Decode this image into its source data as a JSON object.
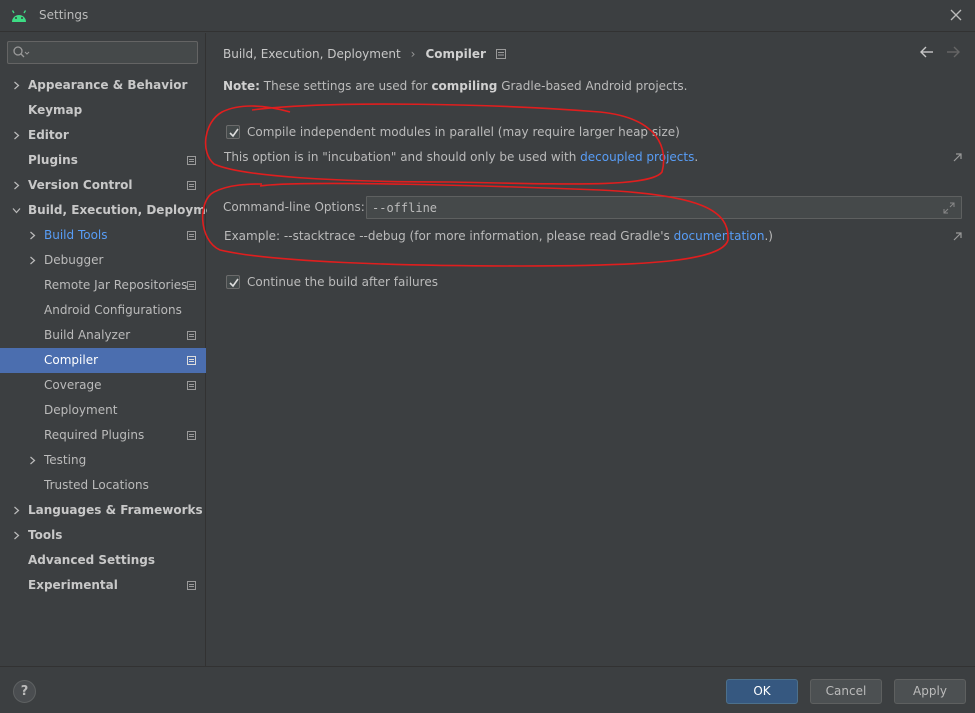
{
  "window": {
    "title": "Settings"
  },
  "sidebar": {
    "search_placeholder": "",
    "items": [
      {
        "label": "Appearance & Behavior",
        "bold": true,
        "chevron": "right",
        "level": 0
      },
      {
        "label": "Keymap",
        "bold": true,
        "chevron": "none",
        "level": 0
      },
      {
        "label": "Editor",
        "bold": true,
        "chevron": "right",
        "level": 0
      },
      {
        "label": "Plugins",
        "bold": true,
        "chevron": "none",
        "level": 0,
        "project": true
      },
      {
        "label": "Version Control",
        "bold": true,
        "chevron": "right",
        "level": 0,
        "project": true
      },
      {
        "label": "Build, Execution, Deployment",
        "bold": true,
        "chevron": "down",
        "level": 0
      },
      {
        "label": "Build Tools",
        "chevron": "right",
        "level": 1,
        "project": true,
        "link": true
      },
      {
        "label": "Debugger",
        "chevron": "right",
        "level": 1
      },
      {
        "label": "Remote Jar Repositories",
        "chevron": "none",
        "level": 1,
        "project": true
      },
      {
        "label": "Android Configurations",
        "chevron": "none",
        "level": 1
      },
      {
        "label": "Build Analyzer",
        "chevron": "none",
        "level": 1,
        "project": true
      },
      {
        "label": "Compiler",
        "chevron": "none",
        "level": 1,
        "project": true,
        "selected": true
      },
      {
        "label": "Coverage",
        "chevron": "none",
        "level": 1,
        "project": true
      },
      {
        "label": "Deployment",
        "chevron": "none",
        "level": 1
      },
      {
        "label": "Required Plugins",
        "chevron": "none",
        "level": 1,
        "project": true
      },
      {
        "label": "Testing",
        "chevron": "right",
        "level": 1
      },
      {
        "label": "Trusted Locations",
        "chevron": "none",
        "level": 1
      },
      {
        "label": "Languages & Frameworks",
        "bold": true,
        "chevron": "right",
        "level": 0
      },
      {
        "label": "Tools",
        "bold": true,
        "chevron": "right",
        "level": 0
      },
      {
        "label": "Advanced Settings",
        "bold": true,
        "chevron": "none",
        "level": 0
      },
      {
        "label": "Experimental",
        "bold": true,
        "chevron": "none",
        "level": 0,
        "project": true
      }
    ]
  },
  "main": {
    "breadcrumb": {
      "parent": "Build, Execution, Deployment",
      "current": "Compiler"
    },
    "note": {
      "prefix": "Note:",
      "text1": " These settings are used for ",
      "bold": "compiling",
      "text2": " Gradle-based Android projects."
    },
    "parallel": {
      "checked": true,
      "label": "Compile independent modules in parallel (may require larger heap size)",
      "hint_text": "This option is in \"incubation\" and should only be used with ",
      "hint_link": "decoupled projects",
      "hint_end": "."
    },
    "cmdline": {
      "label": "Command-line Options:",
      "value": "--offline",
      "hint_text": "Example: --stacktrace --debug (for more information, please read Gradle's ",
      "hint_link": "documentation",
      "hint_end": ".)"
    },
    "continue_build": {
      "checked": true,
      "label": "Continue the build after failures"
    }
  },
  "footer": {
    "help": "?",
    "ok": "OK",
    "cancel": "Cancel",
    "apply": "Apply"
  },
  "colors": {
    "accent": "#4b6eaf",
    "link": "#589df6",
    "annotation": "#e01e1e"
  }
}
